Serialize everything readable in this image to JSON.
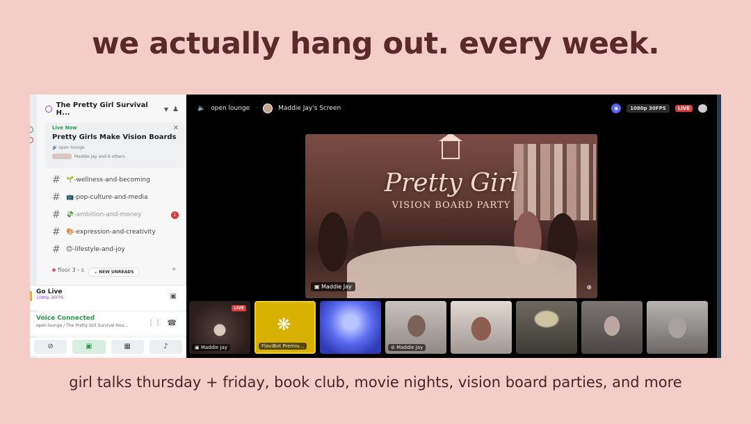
{
  "headline": "we actually hang out. every week.",
  "caption": "girl talks thursday + friday, book club, movie nights, vision board parties, and more",
  "sidebar": {
    "server_name": "The Pretty Girl Survival H...",
    "live_card": {
      "status": "Live Now",
      "title": "Pretty Girls Make Vision Boards",
      "channel": "open lounge",
      "who": "Maddie Jay and 6 others"
    },
    "channels": [
      {
        "label": "🌱-wellness-and-becoming",
        "muted": false
      },
      {
        "label": "📺-pop-culture-and-media",
        "muted": false
      },
      {
        "label": "💸-ambition-and-money",
        "muted": true,
        "badge": "1"
      },
      {
        "label": "🎨-expression-and-creativity",
        "muted": false
      },
      {
        "label": "😊-lifestyle-and-joy",
        "muted": false
      }
    ],
    "floor_label": "floor 3 - s",
    "new_unreads": "NEW UNREADS",
    "go_live": {
      "title": "Go Live",
      "sub": "1080p 30FPS"
    },
    "voice": {
      "title": "Voice Connected",
      "sub": "open lounge / The Pretty Girl Survival Hou..."
    }
  },
  "stage": {
    "channel": "open lounge",
    "screen_owner": "Maddie Jay's Screen",
    "quality": "1080p 30FPS",
    "live_badge": "LIVE",
    "main_video": {
      "script_title": "Pretty Girl",
      "subtitle": "VISION BOARD PARTY",
      "label": "Maddie Jay"
    },
    "tiles": [
      {
        "label": "Maddie Jay",
        "live": "LIVE"
      },
      {
        "label": "FlaviBot Premiu..."
      },
      {
        "label": ""
      },
      {
        "label": "Maddie Jay"
      },
      {
        "label": ""
      },
      {
        "label": ""
      },
      {
        "label": ""
      },
      {
        "label": ""
      }
    ]
  }
}
